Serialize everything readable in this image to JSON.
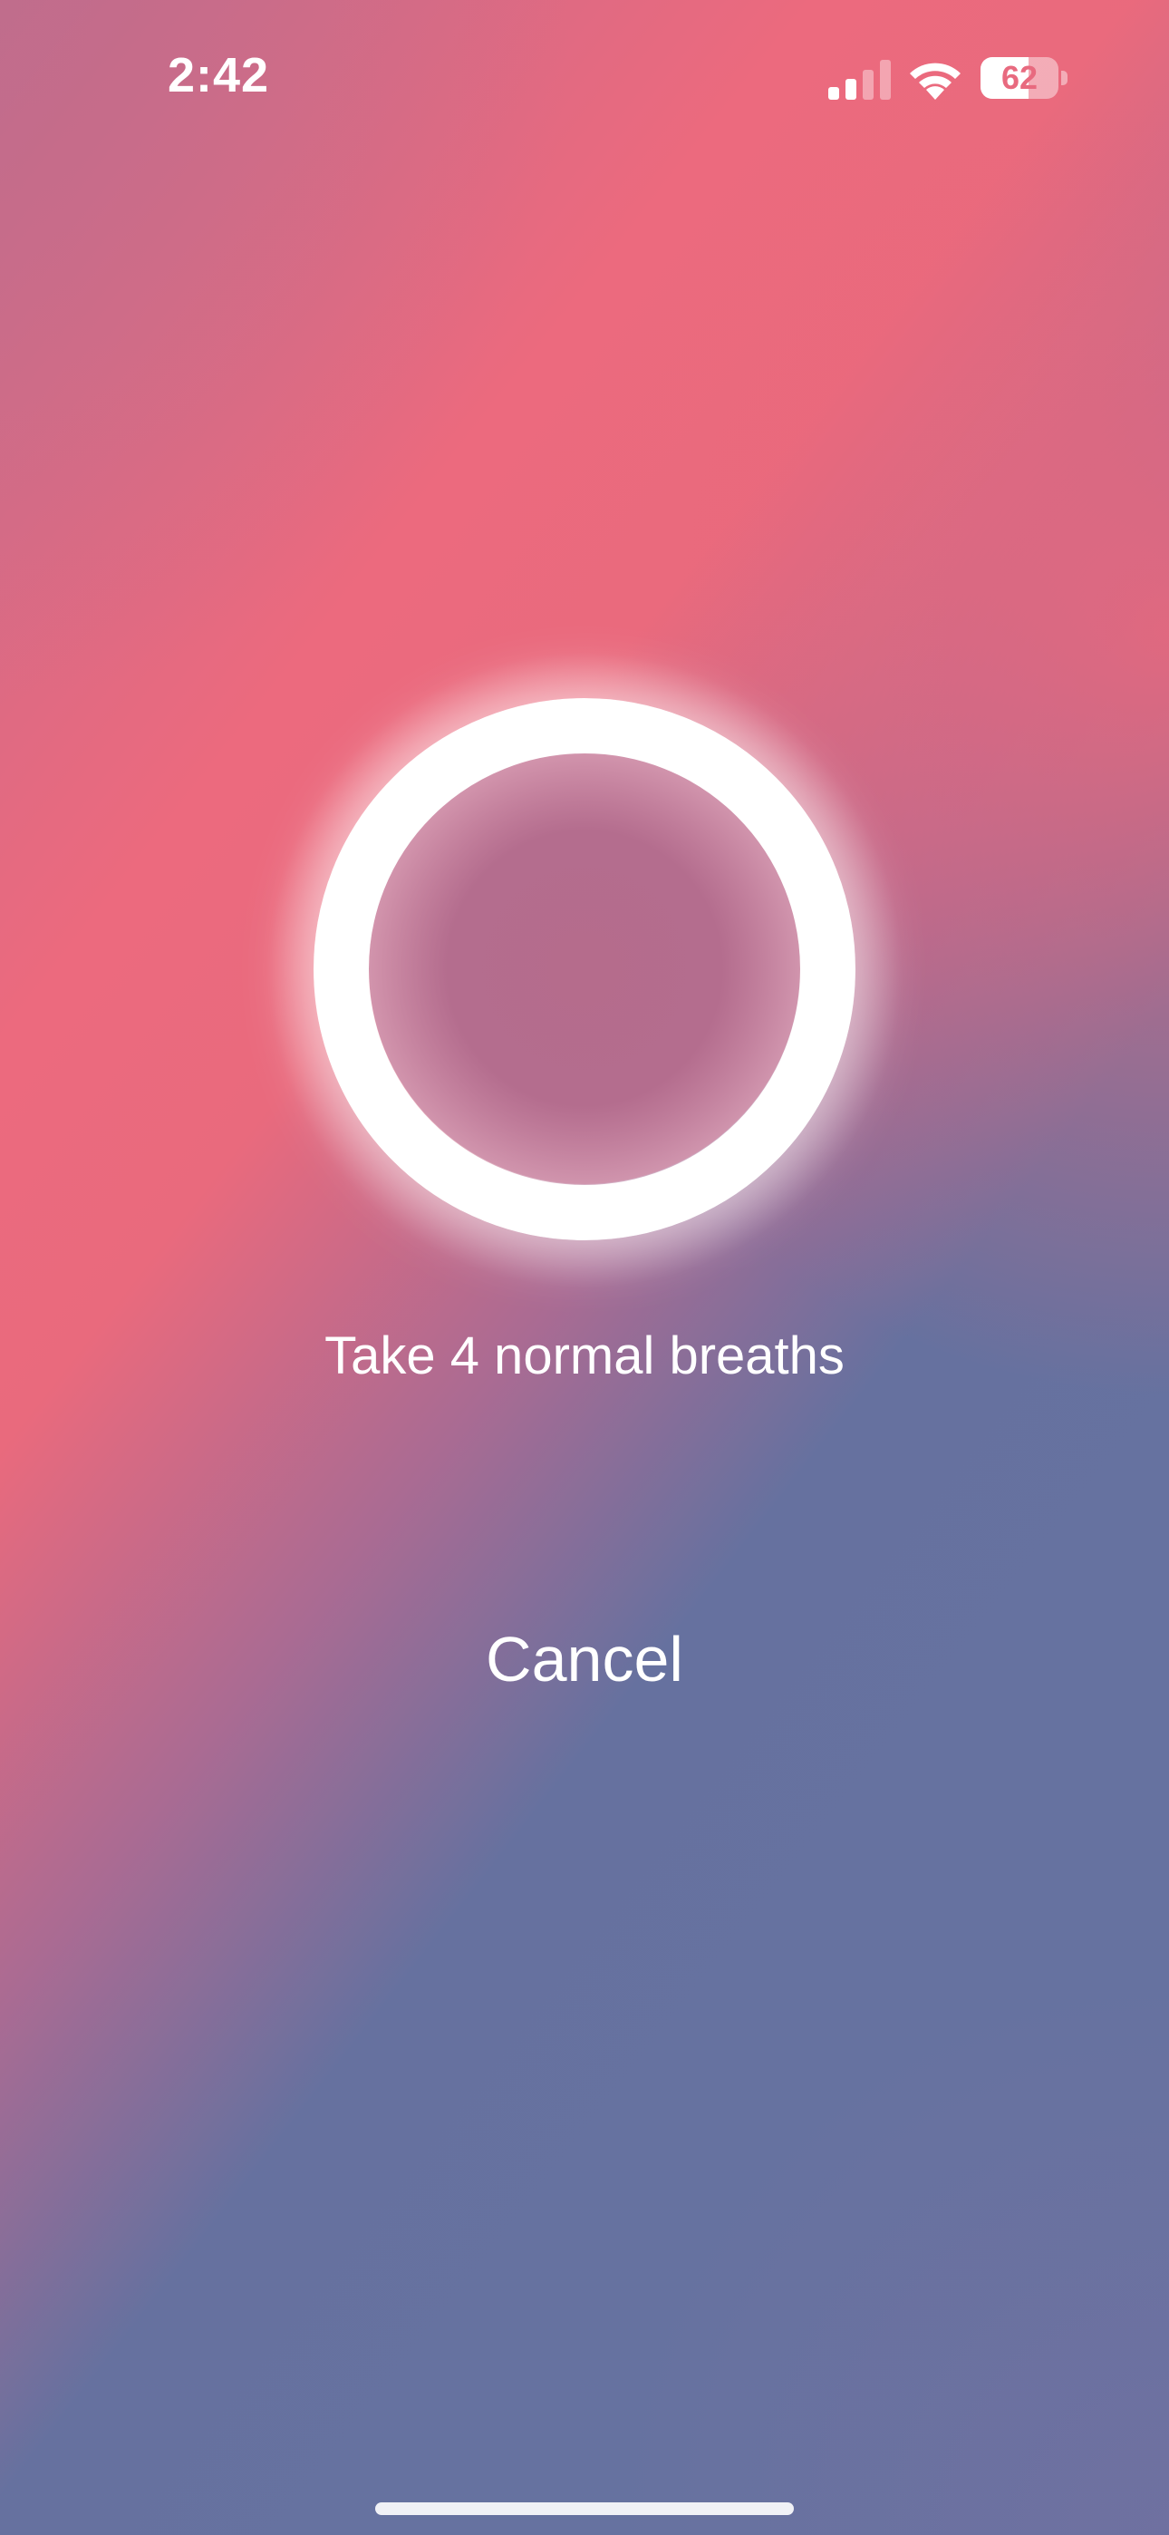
{
  "status_bar": {
    "time": "2:42",
    "battery_level": "62",
    "battery_fraction": 0.62,
    "signal_bars_active": 2,
    "signal_bars_total": 4,
    "icons": [
      "signal-icon",
      "wifi-icon",
      "battery-icon"
    ]
  },
  "breathe": {
    "instruction": "Take 4 normal breaths",
    "cancel_label": "Cancel"
  },
  "colors": {
    "gradient_top": "#ec6a7e",
    "gradient_bottom": "#6673a1",
    "ring": "#ffffff",
    "text": "#ffffff"
  }
}
